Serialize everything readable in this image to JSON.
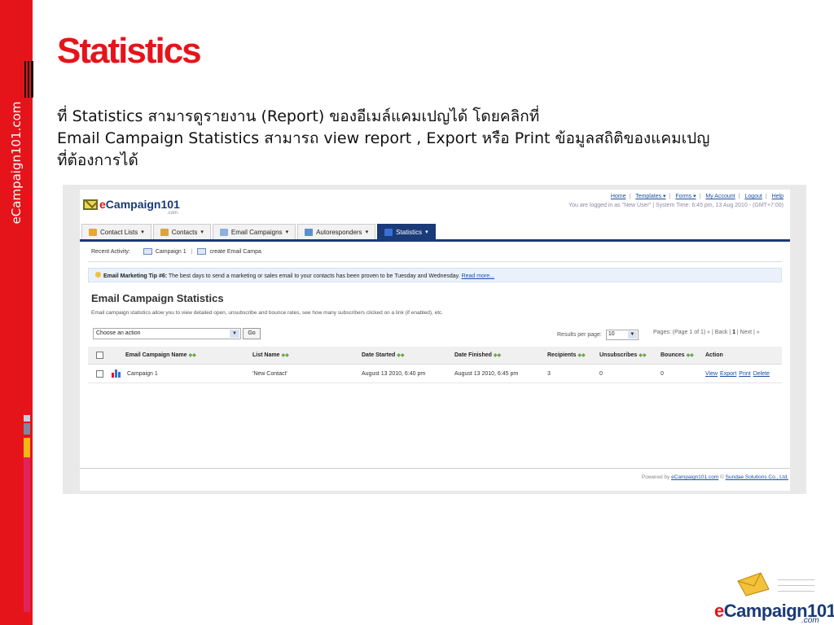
{
  "sidebar": {
    "vertical_text": "eCampaign101.com"
  },
  "slide": {
    "title": "Statistics",
    "lines": [
      "ที่ Statistics สามารดูรายงาน (Report) ของอีเมล์แคมเปญได้ โดยคลิกที่",
      "Email Campaign Statistics สามารถ view report , Export หรือ Print ข้อมูลสถิติของแคมเปญ",
      "ที่ต้องการได้"
    ]
  },
  "app": {
    "logo": {
      "prefix": "e",
      "name": "Campaign101",
      "suffix": ".com"
    },
    "toplinks": [
      "Home",
      "Templates ▾",
      "Forms ▾",
      "My Account",
      "Logout",
      "Help"
    ],
    "status_line": "You are logged in as \"New User\" | System Time: 6:45 pm, 13 Aug 2010 - (GMT+7:00)",
    "tabs": [
      {
        "label": "Contact Lists",
        "icon": "contact-lists-icon",
        "color": "#e8a53a"
      },
      {
        "label": "Contacts",
        "icon": "contacts-icon",
        "color": "#d9a441"
      },
      {
        "label": "Email Campaigns",
        "icon": "email-campaigns-icon",
        "color": "#8fb0dd"
      },
      {
        "label": "Autoresponders",
        "icon": "autoresponders-icon",
        "color": "#5c8fcf"
      },
      {
        "label": "Statistics",
        "icon": "statistics-icon",
        "color": "#3a6fd8"
      }
    ],
    "recent": {
      "label": "Recent Activity:",
      "items": [
        "Campaign 1",
        "create Email Campa"
      ]
    },
    "tip": {
      "bold": "Email Marketing Tip #6:",
      "text": " The best days to send a marketing or sales email to your contacts has been proven to be Tuesday and Wednesday.",
      "link": "Read more..."
    },
    "section_title": "Email Campaign Statistics",
    "section_desc": "Email campaign statistics allow you to view detailed open, unsubscribe and bounce rates, see how many subscribers clicked on a link (if enabled), etc.",
    "action_select": "Choose an action",
    "go_label": "Go",
    "perpage_label": "Results per page:",
    "perpage_value": "10",
    "pager": {
      "pages": "Pages: (Page 1 of 1)",
      "nav_prev": "« | Back |",
      "current": "1",
      "nav_next": "| Next | »"
    },
    "columns": [
      "Email Campaign Name",
      "List Name",
      "Date Started",
      "Date Finished",
      "Recipients",
      "Unsubscribes",
      "Bounces",
      "Action"
    ],
    "rows": [
      {
        "name": "Campaign 1",
        "list": "'New Contact'",
        "started": "August 13 2010, 6:40 pm",
        "finished": "August 13 2010, 6:45 pm",
        "recipients": "3",
        "unsubscribes": "0",
        "bounces": "0",
        "actions": [
          "View",
          "Export",
          "Print",
          "Delete"
        ]
      }
    ],
    "powered": {
      "prefix": "Powered by ",
      "site": "eCampaign101.com",
      "mid": " © ",
      "company": "Sundae Solutions Co., Ltd."
    }
  },
  "brand": {
    "e": "e",
    "name": "Campaign101",
    "com": ".com"
  },
  "colors": {
    "accent_red": "#e5141b",
    "navy": "#1a3a78",
    "link_blue": "#1a4fa3"
  }
}
